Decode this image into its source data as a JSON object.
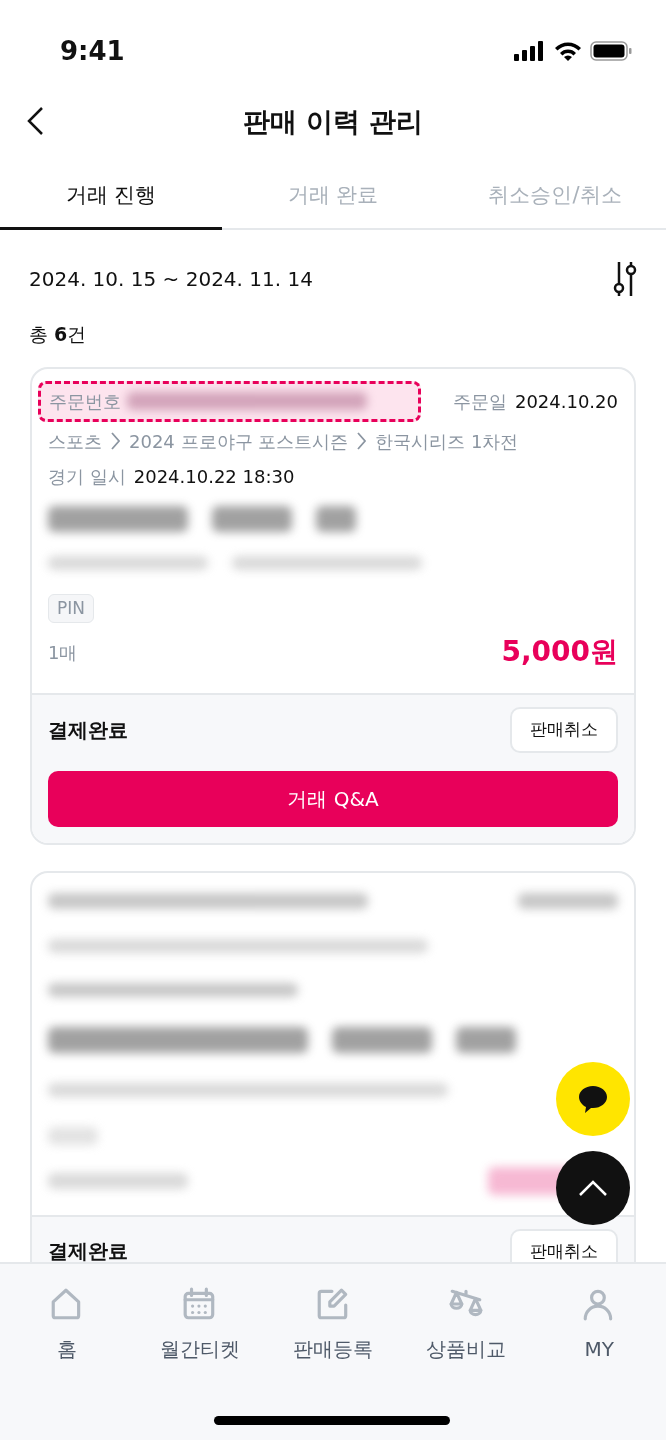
{
  "status_bar": {
    "time": "9:41"
  },
  "header": {
    "title": "판매 이력 관리"
  },
  "tabs": [
    {
      "label": "거래 진행",
      "selected": true
    },
    {
      "label": "거래 완료",
      "selected": false
    },
    {
      "label": "취소승인/취소",
      "selected": false
    }
  ],
  "date_range": "2024. 10. 15 ~ 2024. 11. 14",
  "total": "총 **6**건",
  "orders": [
    {
      "kind": "detailed",
      "order_number_label": "주문번호",
      "highlighted": true,
      "order_date_label": "주문일",
      "order_date": "2024.10.20",
      "breadcrumb": [
        "스포츠",
        "2024 프로야구 포스트시즌",
        "한국시리즈 1차전"
      ],
      "game_time_label": "경기 일시",
      "game_time": "2024.10.22 18:30",
      "tag": "PIN",
      "quantity": "1매",
      "price": "5,000원",
      "status": "결제완료",
      "cancel_button": "판매취소",
      "qa_button": "거래 Q&A"
    },
    {
      "kind": "blurred",
      "status": "결제완료",
      "cancel_button": "판매취소"
    }
  ],
  "nav": [
    {
      "label": "홈"
    },
    {
      "label": "월간티켓"
    },
    {
      "label": "판매등록"
    },
    {
      "label": "상품비교"
    },
    {
      "label": "MY"
    }
  ]
}
